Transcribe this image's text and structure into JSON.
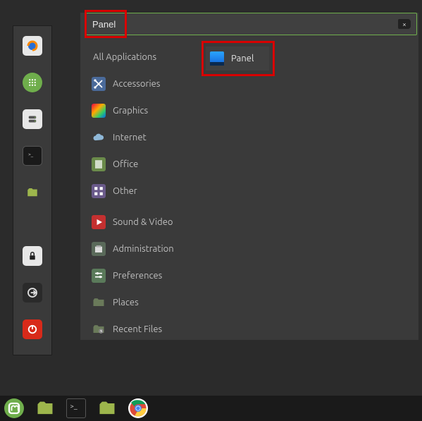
{
  "search": {
    "value": "Panel"
  },
  "categories": [
    {
      "label": "All Applications"
    },
    {
      "label": "Accessories"
    },
    {
      "label": "Graphics"
    },
    {
      "label": "Internet"
    },
    {
      "label": "Office"
    },
    {
      "label": "Other"
    },
    {
      "label": "Sound & Video"
    },
    {
      "label": "Administration"
    },
    {
      "label": "Preferences"
    },
    {
      "label": "Places"
    },
    {
      "label": "Recent Files"
    }
  ],
  "result": {
    "label": "Panel"
  },
  "launcher_items": [
    "firefox",
    "apps",
    "disks",
    "terminal",
    "files",
    "lock",
    "logout",
    "shutdown"
  ],
  "taskbar_items": [
    "mint-menu",
    "files",
    "terminal",
    "file-manager",
    "chrome"
  ],
  "colors": {
    "accent": "#6fae4c",
    "highlight": "#d80000"
  }
}
